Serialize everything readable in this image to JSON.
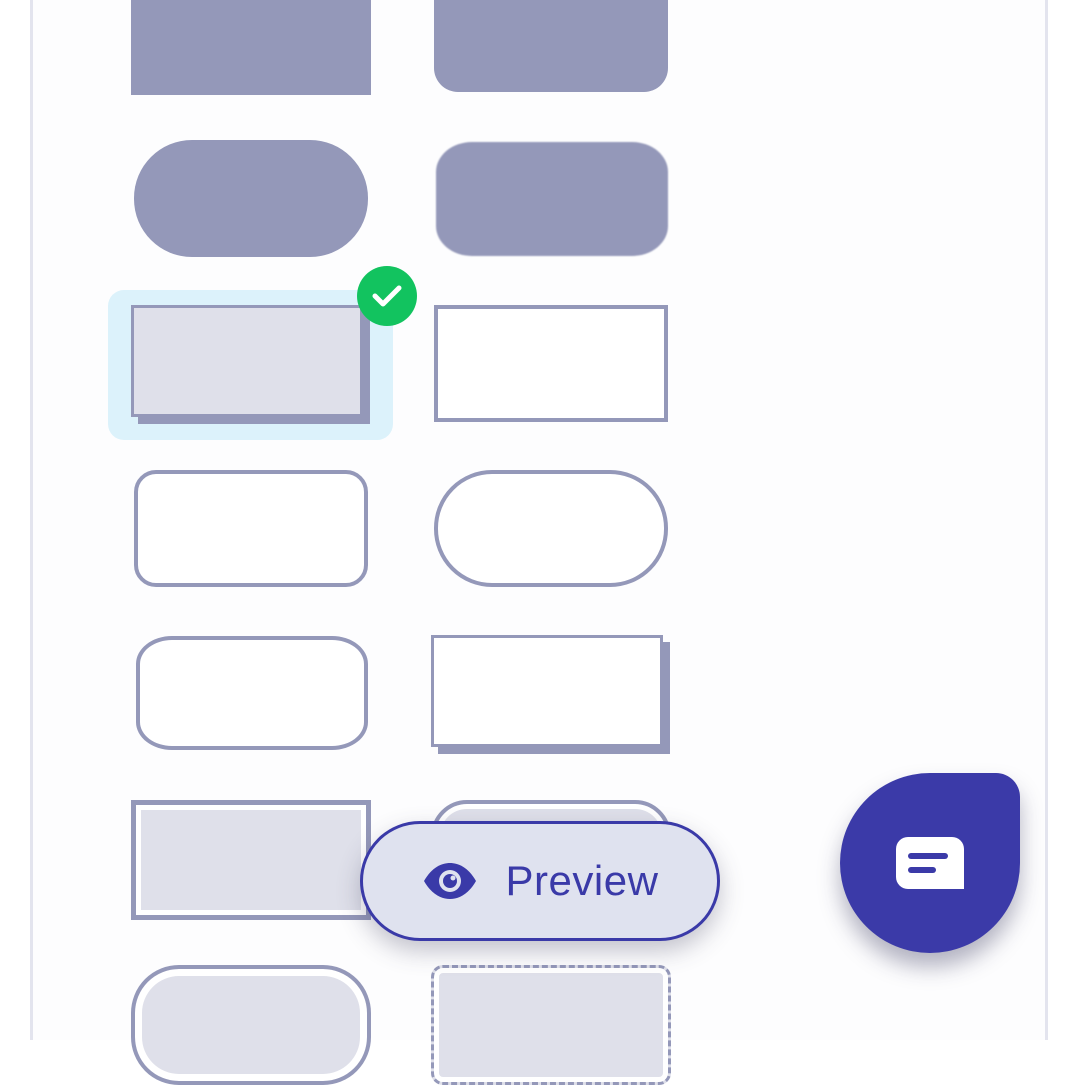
{
  "shape_picker": {
    "shapes": [
      {
        "name": "filled-rectangle"
      },
      {
        "name": "filled-rounded-bottom"
      },
      {
        "name": "filled-pill"
      },
      {
        "name": "filled-soft-blob"
      },
      {
        "name": "shadowed-rectangle",
        "selected": true
      },
      {
        "name": "outline-rectangle"
      },
      {
        "name": "outline-rounded"
      },
      {
        "name": "outline-pill"
      },
      {
        "name": "outline-blob"
      },
      {
        "name": "outline-shadowed-rectangle"
      },
      {
        "name": "double-border-rectangle"
      },
      {
        "name": "double-border-rounded"
      },
      {
        "name": "double-border-pill"
      },
      {
        "name": "dashed-rounded"
      }
    ],
    "selected_indicator_icon": "check-icon",
    "selected_color": "#12c35f"
  },
  "preview": {
    "label": "Preview",
    "icon": "eye-icon"
  },
  "chat": {
    "icon": "chat-icon",
    "color": "#3b3aa8"
  },
  "colors": {
    "shape_fill": "#9498b9",
    "shape_light": "#dfe0ea",
    "selection_bg": "#dcf2fb",
    "accent": "#3a3aa8"
  }
}
